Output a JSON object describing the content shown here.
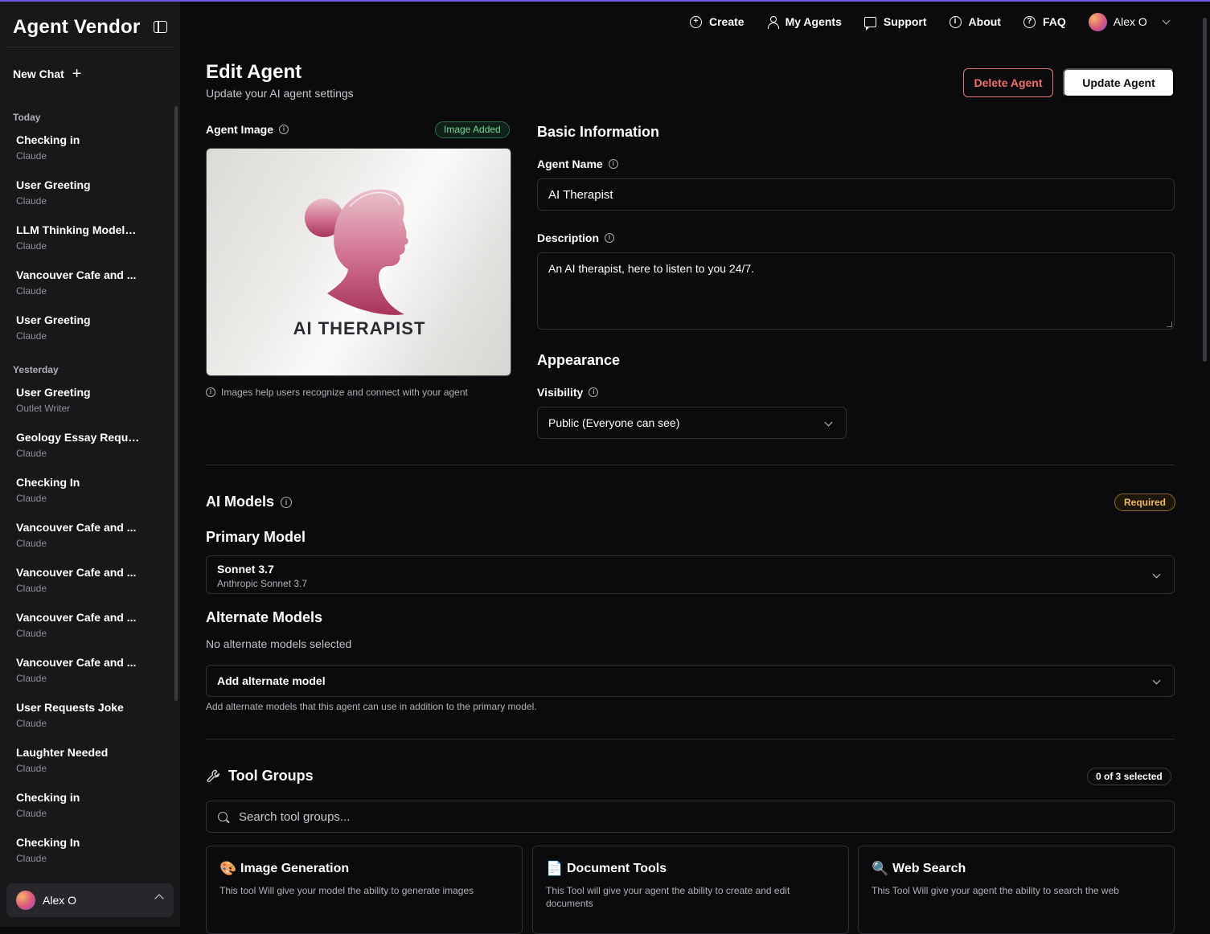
{
  "app": {
    "brand": "Agent Vendor"
  },
  "sidebar": {
    "new_chat": "New Chat",
    "sections": [
      {
        "label": "Today",
        "items": [
          {
            "title": "Checking in",
            "sub": "Claude"
          },
          {
            "title": "User Greeting",
            "sub": "Claude"
          },
          {
            "title": "LLM Thinking Models ...",
            "sub": "Claude"
          },
          {
            "title": "Vancouver Cafe and ...",
            "sub": "Claude"
          },
          {
            "title": "User Greeting",
            "sub": "Claude"
          }
        ]
      },
      {
        "label": "Yesterday",
        "items": [
          {
            "title": "User Greeting",
            "sub": "Outlet Writer"
          },
          {
            "title": "Geology Essay Reque...",
            "sub": "Claude"
          },
          {
            "title": "Checking In",
            "sub": "Claude"
          },
          {
            "title": "Vancouver Cafe and ...",
            "sub": "Claude"
          },
          {
            "title": "Vancouver Cafe and ...",
            "sub": "Claude"
          },
          {
            "title": "Vancouver Cafe and ...",
            "sub": "Claude"
          },
          {
            "title": "Vancouver Cafe and ...",
            "sub": "Claude"
          },
          {
            "title": "User Requests Joke",
            "sub": "Claude"
          },
          {
            "title": "Laughter Needed",
            "sub": "Claude"
          },
          {
            "title": "Checking in",
            "sub": "Claude"
          },
          {
            "title": "Checking In",
            "sub": "Claude"
          }
        ]
      }
    ],
    "user_name": "Alex O"
  },
  "nav": {
    "create": "Create",
    "my_agents": "My Agents",
    "support": "Support",
    "about": "About",
    "faq": "FAQ",
    "user": "Alex O"
  },
  "page": {
    "title": "Edit Agent",
    "subtitle": "Update your AI agent settings",
    "delete_label": "Delete Agent",
    "update_label": "Update Agent"
  },
  "image_section": {
    "label": "Agent Image",
    "badge": "Image Added",
    "image_text": "AI THERAPIST",
    "help": "Images help users recognize and connect with your agent"
  },
  "basic": {
    "heading": "Basic Information",
    "name_label": "Agent Name",
    "name_value": "AI Therapist",
    "desc_label": "Description",
    "desc_value": "An AI therapist, here to listen to you 24/7."
  },
  "appearance": {
    "heading": "Appearance",
    "visibility_label": "Visibility",
    "visibility_value": "Public (Everyone can see)"
  },
  "models": {
    "heading": "AI Models",
    "required_badge": "Required",
    "primary_heading": "Primary Model",
    "primary_name": "Sonnet 3.7",
    "primary_sub": "Anthropic Sonnet 3.7",
    "alt_heading": "Alternate Models",
    "alt_none": "No alternate models selected",
    "alt_select": "Add alternate model",
    "alt_help": "Add alternate models that this agent can use in addition to the primary model."
  },
  "tools": {
    "heading": "Tool Groups",
    "selected_badge": "0 of 3 selected",
    "search_placeholder": "Search tool groups...",
    "cards": [
      {
        "icon": "palette-icon",
        "emoji": "🎨",
        "title": "Image Generation",
        "desc": "This tool Will give your model the ability to generate images"
      },
      {
        "icon": "document-icon",
        "emoji": "📄",
        "title": "Document Tools",
        "desc": "This Tool will give your agent the ability to create and edit documents"
      },
      {
        "icon": "magnifier-icon",
        "emoji": "🔍",
        "title": "Web Search",
        "desc": "This Tool Will give your agent the ability to search the web"
      }
    ]
  },
  "colors": {
    "accent_red": "#ee6d6d",
    "badge_green": "#7bd59a",
    "badge_amber": "#f0b95a",
    "bg": "#0b0b0d",
    "sidebar_bg": "#18181b"
  }
}
